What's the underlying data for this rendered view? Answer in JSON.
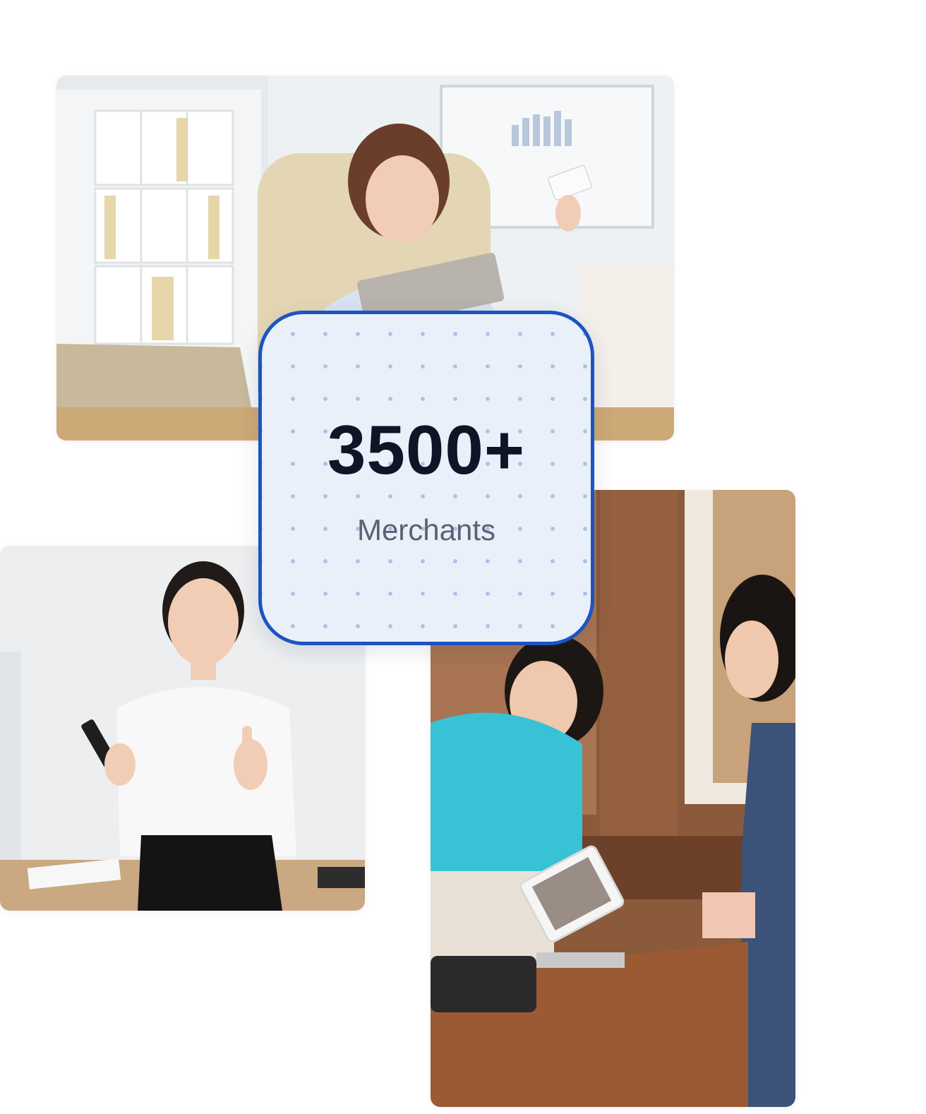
{
  "stats": {
    "value": "3500+",
    "label": "Merchants"
  },
  "colors": {
    "card_border": "#1c54c2",
    "card_background": "#e9f0fa",
    "value_text": "#0d1526",
    "label_text": "#5b6270"
  }
}
